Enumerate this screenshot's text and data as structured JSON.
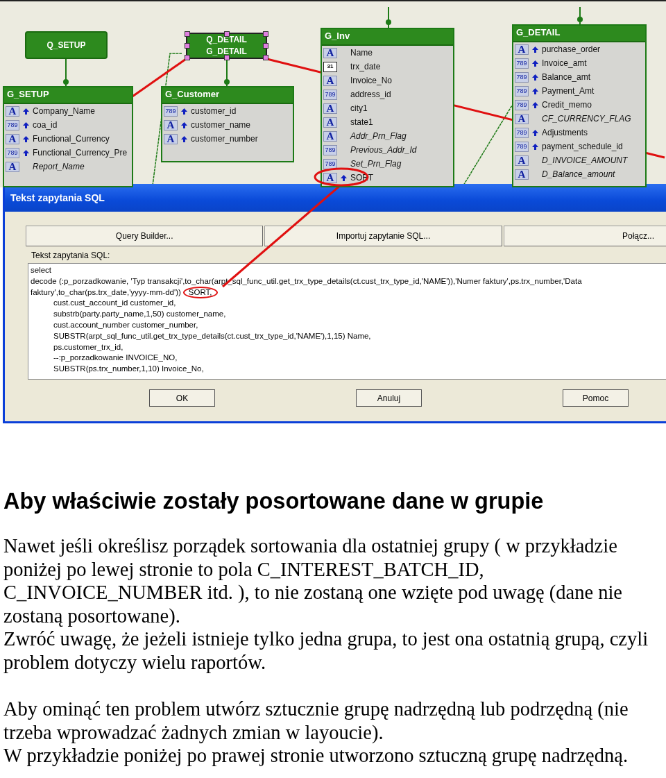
{
  "diagram": {
    "queries": [
      {
        "lines": [
          "Q_SETUP"
        ],
        "selected": false
      },
      {
        "lines": [
          "Q_DETAIL",
          "G_DETAIL"
        ],
        "selected": true
      }
    ],
    "groups": [
      {
        "title": "G_SETUP",
        "fields": [
          {
            "icon": "A",
            "kind": "char",
            "arrow": true,
            "computed": false,
            "name": "Company_Name"
          },
          {
            "icon": "789",
            "kind": "number",
            "arrow": true,
            "computed": false,
            "name": "coa_id"
          },
          {
            "icon": "A",
            "kind": "char",
            "arrow": true,
            "computed": false,
            "name": "Functional_Currency"
          },
          {
            "icon": "789",
            "kind": "number",
            "arrow": true,
            "computed": false,
            "name": "Functional_Currency_Pre"
          },
          {
            "icon": "A",
            "kind": "char",
            "arrow": false,
            "computed": true,
            "name": "Report_Name"
          }
        ]
      },
      {
        "title": "G_Customer",
        "fields": [
          {
            "icon": "789",
            "kind": "number",
            "arrow": true,
            "computed": false,
            "name": "customer_id"
          },
          {
            "icon": "A",
            "kind": "char",
            "arrow": true,
            "computed": false,
            "name": "customer_name"
          },
          {
            "icon": "A",
            "kind": "char",
            "arrow": true,
            "computed": false,
            "name": "customer_number"
          }
        ]
      },
      {
        "title": "G_Inv",
        "fields": [
          {
            "icon": "A",
            "kind": "char",
            "arrow": false,
            "computed": false,
            "name": "Name"
          },
          {
            "icon": "31",
            "kind": "date",
            "arrow": false,
            "computed": false,
            "name": "trx_date"
          },
          {
            "icon": "A",
            "kind": "char",
            "arrow": false,
            "computed": false,
            "name": "Invoice_No"
          },
          {
            "icon": "789",
            "kind": "number",
            "arrow": false,
            "computed": false,
            "name": "address_id"
          },
          {
            "icon": "A",
            "kind": "char",
            "arrow": false,
            "computed": false,
            "name": "city1"
          },
          {
            "icon": "A",
            "kind": "char",
            "arrow": false,
            "computed": false,
            "name": "state1"
          },
          {
            "icon": "A",
            "kind": "char",
            "arrow": false,
            "computed": true,
            "name": "Addr_Prn_Flag"
          },
          {
            "icon": "789",
            "kind": "number",
            "arrow": false,
            "computed": true,
            "name": "Previous_Addr_Id"
          },
          {
            "icon": "789",
            "kind": "number",
            "arrow": false,
            "computed": true,
            "name": "Set_Prn_Flag"
          },
          {
            "icon": "A",
            "kind": "char",
            "arrow": true,
            "computed": false,
            "name": "SORT"
          }
        ]
      },
      {
        "title": "G_DETAIL",
        "fields": [
          {
            "icon": "A",
            "kind": "char",
            "arrow": true,
            "computed": false,
            "name": "purchase_order"
          },
          {
            "icon": "789",
            "kind": "number",
            "arrow": true,
            "computed": false,
            "name": "Invoice_amt"
          },
          {
            "icon": "789",
            "kind": "number",
            "arrow": true,
            "computed": false,
            "name": "Balance_amt"
          },
          {
            "icon": "789",
            "kind": "number",
            "arrow": true,
            "computed": false,
            "name": "Payment_Amt"
          },
          {
            "icon": "789",
            "kind": "number",
            "arrow": true,
            "computed": false,
            "name": "Credit_memo"
          },
          {
            "icon": "A",
            "kind": "char",
            "arrow": false,
            "computed": true,
            "name": "CF_CURRENCY_FLAG"
          },
          {
            "icon": "789",
            "kind": "number",
            "arrow": true,
            "computed": false,
            "name": "Adjustments"
          },
          {
            "icon": "789",
            "kind": "number",
            "arrow": true,
            "computed": false,
            "name": "payment_schedule_id"
          },
          {
            "icon": "A",
            "kind": "char",
            "arrow": false,
            "computed": true,
            "name": "D_INVOICE_AMOUNT"
          },
          {
            "icon": "A",
            "kind": "char",
            "arrow": false,
            "computed": true,
            "name": "D_Balance_amount"
          }
        ]
      }
    ]
  },
  "dialog": {
    "title": "Tekst zapytania SQL",
    "buttons": [
      "Query Builder...",
      "Importuj zapytanie SQL...",
      "Połącz..."
    ],
    "sql_label": "Tekst zapytania SQL:",
    "sql_lines": [
      {
        "text": "select",
        "indented": false
      },
      {
        "text": "decode (:p_porzadkowanie, 'Typ transakcji',to_char(arpt_sql_func_util.get_trx_type_details(ct.cust_trx_type_id,'NAME')),'Numer faktury',ps.trx_number,'Data",
        "indented": false
      },
      {
        "text": "faktury',to_char(ps.trx_date,'yyyy-mm-dd'))",
        "circled": "SORT,",
        "indented": false
      },
      {
        "text": "cust.cust_account_id customer_id,",
        "indented": true
      },
      {
        "text": "substrb(party.party_name,1,50) customer_name,",
        "indented": true
      },
      {
        "text": "cust.account_number customer_number,",
        "indented": true
      },
      {
        "text": "SUBSTR(arpt_sql_func_util.get_trx_type_details(ct.cust_trx_type_id,'NAME'),1,15)  Name,",
        "indented": true
      },
      {
        "text": "ps.customer_trx_id,",
        "indented": true
      },
      {
        "text": "--:p_porzadkowanie INVOICE_NO,",
        "indented": true
      },
      {
        "text": "SUBSTR(ps.trx_number,1,10)  Invoice_No,",
        "indented": true
      }
    ],
    "footer_buttons": [
      "OK",
      "Anuluj",
      "Pomoc"
    ]
  },
  "heading": "Aby właściwie zostały posortowane dane w grupie",
  "blocks": [
    [
      "Nawet jeśli określisz porządek sortowania dla ostatniej grupy ( w przykładzie poniżej po lewej stronie to pola C_INTEREST_BATCH_ID, C_INVOICE_NUMBER itd. ), to nie zostaną one wzięte pod uwagę (dane nie zostaną posortowane).",
      "Zwróć uwagę, że jeżeli istnieje tylko jedna grupa, to jest ona ostatnią grupą, czyli problem dotyczy wielu raportów."
    ],
    [
      "Aby ominąć ten problem utwórz sztucznie grupę nadrzędną lub podrzędną (nie trzeba wprowadzać żadnych zmian w layoucie).",
      "W przykładzie poniżej po prawej stronie utworzono sztuczną grupę nadrzędną."
    ]
  ]
}
